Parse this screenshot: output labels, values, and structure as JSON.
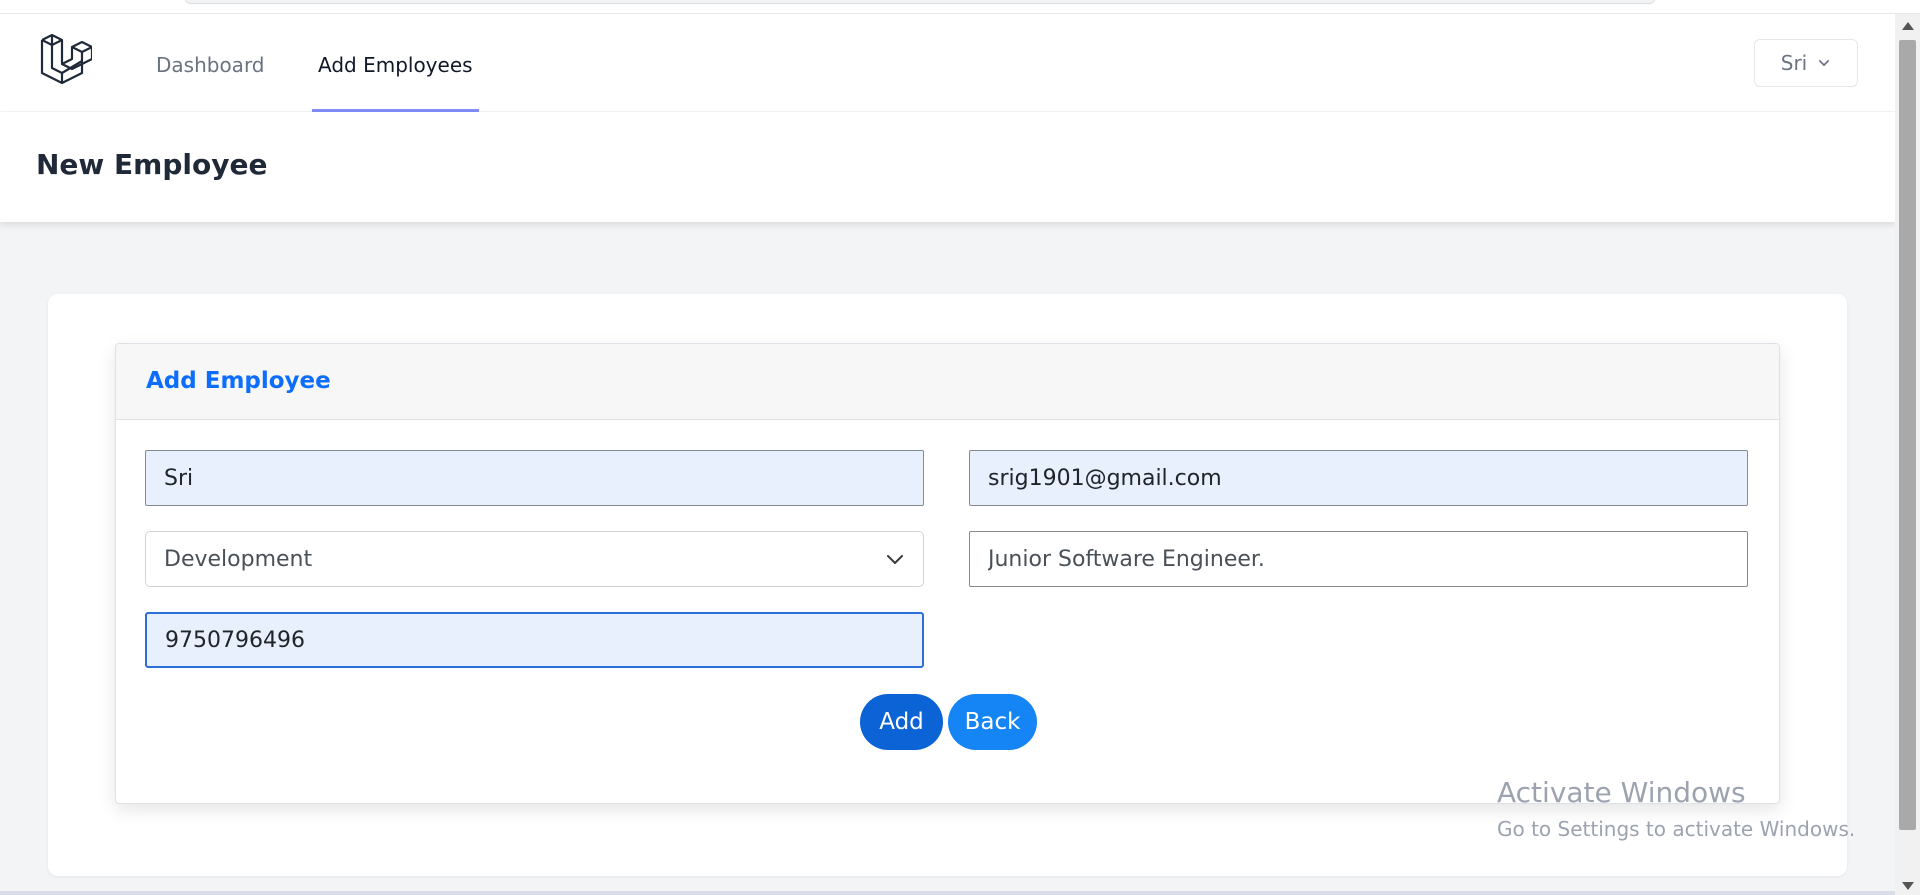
{
  "nav": {
    "links": {
      "dashboard": "Dashboard",
      "add_employees": "Add Employees"
    },
    "user_menu_label": "Sri",
    "active_color": "#818cf8"
  },
  "header": {
    "title": "New Employee"
  },
  "form": {
    "card_title": "Add Employee",
    "name_value": "Sri",
    "email_value": "srig1901@gmail.com",
    "department_selected": "Development",
    "designation_value": "Junior Software Engineer.",
    "phone_value": "9750796496",
    "add_button": "Add",
    "back_button": "Back"
  },
  "watermark": {
    "title": "Activate Windows",
    "subtitle": "Go to Settings to activate Windows."
  },
  "colors": {
    "primary": "#0d6efd",
    "autofill_bg": "#e8f0fe"
  },
  "icons": {
    "logo": "laravel-logo",
    "user_dropdown": "chevron-down-icon",
    "select_dropdown": "chevron-down-icon"
  }
}
